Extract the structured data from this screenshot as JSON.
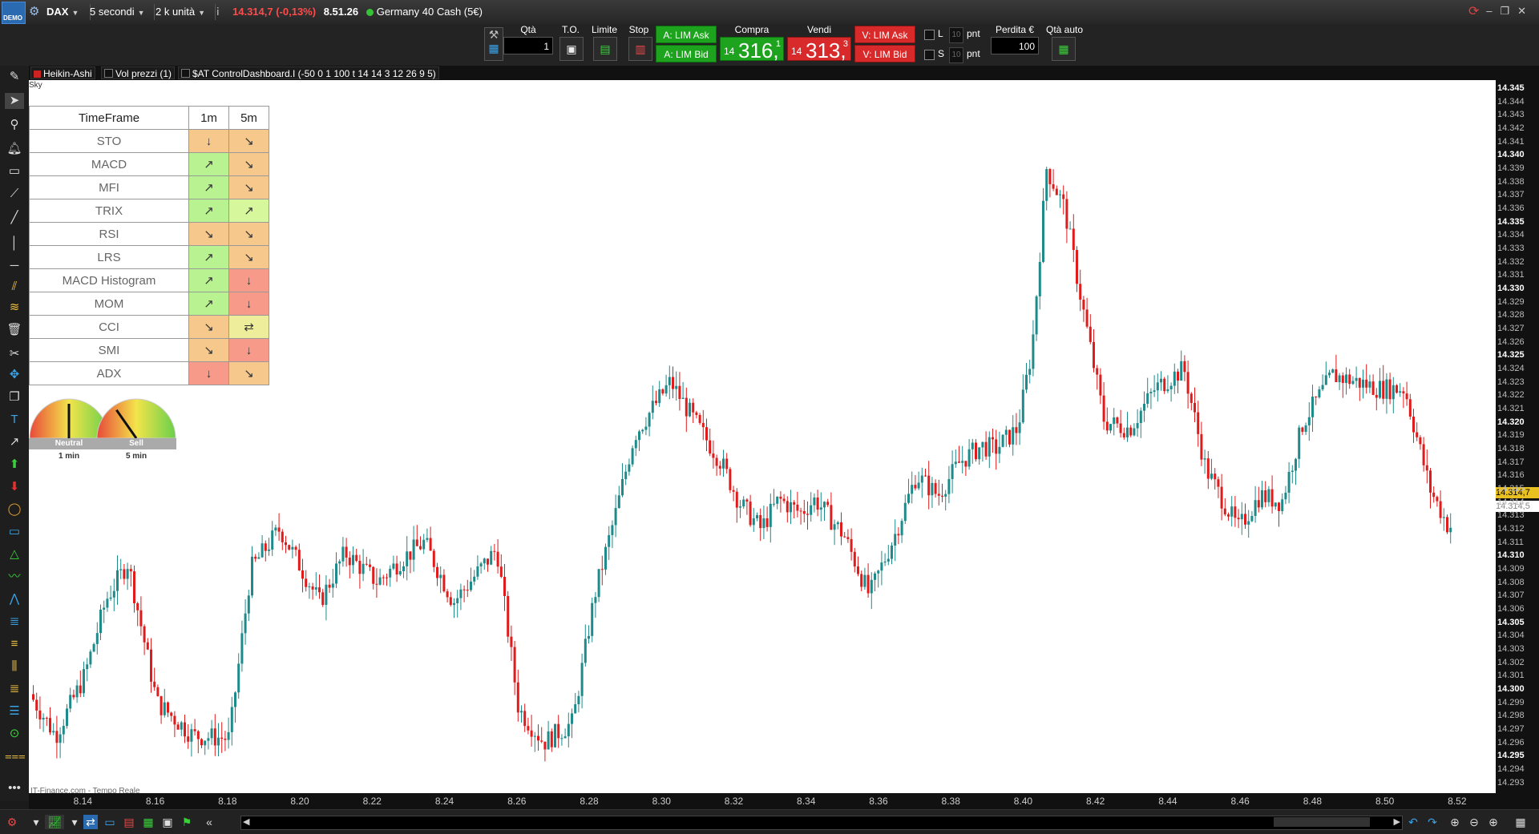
{
  "titlebar": {
    "demo_label": "DEMO",
    "symbol": "DAX",
    "timeframe": "5 secondi",
    "units": "2 k unità",
    "last_price": "14.314,7 (-0,13%)",
    "time": "8.51.26",
    "instrument_name": "Germany 40 Cash (5€)"
  },
  "toolbar": {
    "qty_label": "Qtà",
    "qty_value": "1",
    "to_label": "T.O.",
    "limite_label": "Limite",
    "stop_label": "Stop",
    "buy_ask": "A: LIM Ask",
    "buy_bid": "A: LIM Bid",
    "compra_label": "Compra",
    "compra_prefix": "14",
    "compra_price": "316,",
    "compra_sup": "1",
    "vendi_label": "Vendi",
    "vendi_prefix": "14",
    "vendi_price": "313,",
    "vendi_sup": "3",
    "sell_ask": "V: LIM Ask",
    "sell_bid": "V: LIM Bid",
    "l_label": "L",
    "s_label": "S",
    "pnt_value": "10",
    "pnt_label": "pnt",
    "perdita_label": "Perdita €",
    "perdita_value": "100",
    "qta_auto_label": "Qtà auto"
  },
  "indicators": [
    {
      "name": "Heikin-Ashi",
      "color": "#cc2222"
    },
    {
      "name": "Vol prezzi (1)",
      "color": "#111111"
    },
    {
      "name": "$AT ControlDashboard.I (-50 0 1 100 t 14 14 3 12 26 9 5)",
      "color": "#111111"
    }
  ],
  "dashboard": {
    "overlay_label": "Sky",
    "header": [
      "TimeFrame",
      "1m",
      "5m"
    ],
    "rows": [
      {
        "name": "STO",
        "c1": "↓",
        "k1": "o1",
        "c2": "↘",
        "k2": "o1"
      },
      {
        "name": "MACD",
        "c1": "↗",
        "k1": "g1",
        "c2": "↘",
        "k2": "o1"
      },
      {
        "name": "MFI",
        "c1": "↗",
        "k1": "g1",
        "c2": "↘",
        "k2": "o1"
      },
      {
        "name": "TRIX",
        "c1": "↗",
        "k1": "g1",
        "c2": "↗",
        "k2": "lg"
      },
      {
        "name": "RSI",
        "c1": "↘",
        "k1": "o1",
        "c2": "↘",
        "k2": "o1"
      },
      {
        "name": "LRS",
        "c1": "↗",
        "k1": "g1",
        "c2": "↘",
        "k2": "o1"
      },
      {
        "name": "MACD Histogram",
        "c1": "↗",
        "k1": "g1",
        "c2": "↓",
        "k2": "r1"
      },
      {
        "name": "MOM",
        "c1": "↗",
        "k1": "g1",
        "c2": "↓",
        "k2": "r1"
      },
      {
        "name": "CCI",
        "c1": "↘",
        "k1": "o1",
        "c2": "⇄",
        "k2": "dy"
      },
      {
        "name": "SMI",
        "c1": "↘",
        "k1": "o1",
        "c2": "↓",
        "k2": "r1"
      },
      {
        "name": "ADX",
        "c1": "↓",
        "k1": "r1",
        "c2": "↘",
        "k2": "o1"
      }
    ],
    "gauges": [
      {
        "status": "Neutral",
        "timeframe": "1 min",
        "needle_deg": 0
      },
      {
        "status": "Sell",
        "timeframe": "5 min",
        "needle_deg": -35
      }
    ]
  },
  "chart": {
    "watermark": "IT-Finance.com - Tempo Reale",
    "last_price_label": "14.314,7",
    "last_price_label_2": "14.314,5",
    "up_color": "#1f8a8a",
    "down_color": "#e01b1b"
  },
  "chart_data": {
    "type": "candlestick",
    "x_ticks": [
      "8.14",
      "8.16",
      "8.18",
      "8.20",
      "8.22",
      "8.24",
      "8.26",
      "8.28",
      "8.30",
      "8.32",
      "8.34",
      "8.36",
      "8.38",
      "8.40",
      "8.42",
      "8.44",
      "8.46",
      "8.48",
      "8.50",
      "8.52"
    ],
    "y_ticks": [
      "14.345",
      "14.344",
      "14.343",
      "14.342",
      "14.341",
      "14.340",
      "14.339",
      "14.338",
      "14.337",
      "14.336",
      "14.335",
      "14.334",
      "14.333",
      "14.332",
      "14.331",
      "14.330",
      "14.329",
      "14.328",
      "14.327",
      "14.326",
      "14.325",
      "14.324",
      "14.323",
      "14.322",
      "14.321",
      "14.320",
      "14.319",
      "14.318",
      "14.317",
      "14.316",
      "14.315",
      "14.314",
      "14.313",
      "14.312",
      "14.311",
      "14.310",
      "14.309",
      "14.308",
      "14.307",
      "14.306",
      "14.305",
      "14.304",
      "14.303",
      "14.302",
      "14.301",
      "14.300",
      "14.299",
      "14.298",
      "14.297",
      "14.296",
      "14.295",
      "14.294",
      "14.293"
    ],
    "major_ticks": [
      "14.345",
      "14.340",
      "14.335",
      "14.330",
      "14.325",
      "14.320",
      "14.310",
      "14.305",
      "14.300",
      "14.295"
    ],
    "ylim": [
      14292.2,
      14345.6
    ],
    "xlim_minutes": [
      8.125,
      8.5306
    ],
    "path_times": [
      8.125,
      8.133,
      8.141,
      8.147,
      8.153,
      8.161,
      8.171,
      8.181,
      8.187,
      8.195,
      8.206,
      8.213,
      8.222,
      8.229,
      8.235,
      8.243,
      8.249,
      8.255,
      8.261,
      8.268,
      8.276,
      8.282,
      8.288,
      8.293,
      8.303,
      8.311,
      8.317,
      8.322,
      8.328,
      8.333,
      8.339,
      8.343,
      8.351,
      8.358,
      8.365,
      8.371,
      8.377,
      8.383,
      8.389,
      8.393,
      8.399,
      8.403,
      8.407,
      8.412,
      8.416,
      8.423,
      8.43,
      8.437,
      8.445,
      8.451,
      8.46,
      8.466,
      8.472,
      8.478,
      8.486,
      8.493,
      8.499,
      8.506,
      8.513,
      8.518
    ],
    "path_prices": [
      14300,
      14296.5,
      14301,
      14306.7,
      14309.5,
      14299,
      14296.5,
      14296.3,
      14309,
      14312,
      14306.5,
      14310.2,
      14308,
      14309.8,
      14311,
      14306.5,
      14308.5,
      14310.5,
      14298.5,
      14296,
      14297.5,
      14307,
      14313.3,
      14319,
      14323,
      14319.5,
      14317,
      14314,
      14312,
      14314.2,
      14313.2,
      14314.2,
      14311.5,
      14307,
      14311.5,
      14316,
      14314.5,
      14317,
      14318.2,
      14318,
      14319.5,
      14325.5,
      14339,
      14336,
      14330,
      14320,
      14319.5,
      14322.5,
      14324,
      14316.5,
      14312,
      14314.5,
      14314,
      14320,
      14323.5,
      14323,
      14322.5,
      14322.5,
      14315,
      14312.2
    ]
  }
}
